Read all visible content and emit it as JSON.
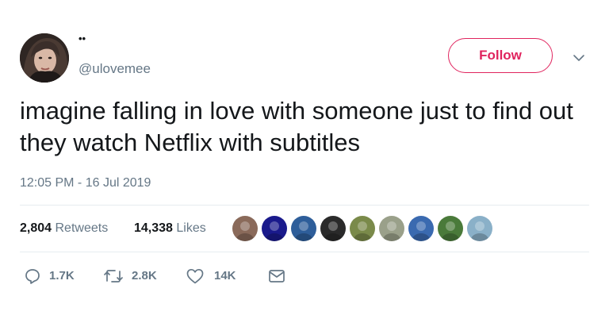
{
  "tweet": {
    "display_name": "••",
    "handle": "@ulovemee",
    "text": "imagine falling in love with someone just to find out they watch Netflix with subtitles",
    "timestamp": "12:05 PM - 16 Jul 2019"
  },
  "header": {
    "follow_label": "Follow",
    "menu_icon": "chevron-down-icon"
  },
  "stats": {
    "retweets_count": "2,804",
    "retweets_label": "Retweets",
    "likes_count": "14,338",
    "likes_label": "Likes"
  },
  "liker_avatars": [
    {
      "name": "liker-avatar-1",
      "color": "#8a6a5a"
    },
    {
      "name": "liker-avatar-2",
      "color": "#1a1a8c"
    },
    {
      "name": "liker-avatar-3",
      "color": "#2e5e9a"
    },
    {
      "name": "liker-avatar-4",
      "color": "#2a2a2a"
    },
    {
      "name": "liker-avatar-5",
      "color": "#7a8a4a"
    },
    {
      "name": "liker-avatar-6",
      "color": "#9aa08a"
    },
    {
      "name": "liker-avatar-7",
      "color": "#3a6ab0"
    },
    {
      "name": "liker-avatar-8",
      "color": "#4a7a3a"
    },
    {
      "name": "liker-avatar-9",
      "color": "#8ab0c8"
    }
  ],
  "actions": {
    "reply_count": "1.7K",
    "retweet_count": "2.8K",
    "like_count": "14K"
  },
  "colors": {
    "follow_accent": "#e0245e",
    "secondary_text": "#657786",
    "primary_text": "#14171a",
    "divider": "#e6ecf0"
  }
}
